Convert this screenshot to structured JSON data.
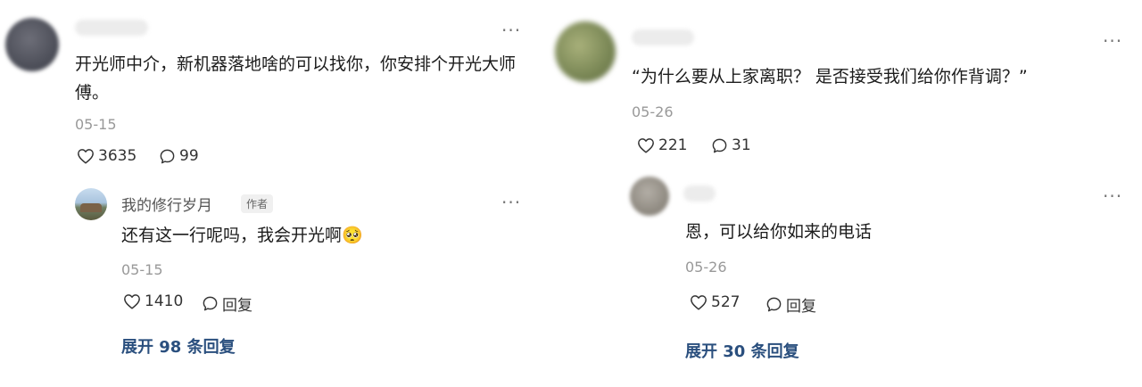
{
  "left": {
    "comment": {
      "text": "开光师中介，新机器落地啥的可以找你，你安排个开光大师傅。",
      "date": "05-15",
      "likes": "3635",
      "comments": "99"
    },
    "reply": {
      "username": "我的修行岁月",
      "badge": "作者",
      "text": "还有这一行呢吗，我会开光啊",
      "emoji": "🥺",
      "date": "05-15",
      "likes": "1410",
      "reply_label": "回复"
    },
    "expand": "展开 98 条回复"
  },
  "right": {
    "comment": {
      "text": "“为什么要从上家离职？ 是否接受我们给你作背调？”",
      "date": "05-26",
      "likes": "221",
      "comments": "31"
    },
    "reply": {
      "text": "恩，可以给你如来的电话",
      "date": "05-26",
      "likes": "527",
      "reply_label": "回复"
    },
    "expand": "展开 30 条回复"
  },
  "more_label": "···",
  "icons": {
    "like": "heart-outline-icon",
    "comment": "speech-bubble-icon",
    "more": "more-dots-icon"
  }
}
